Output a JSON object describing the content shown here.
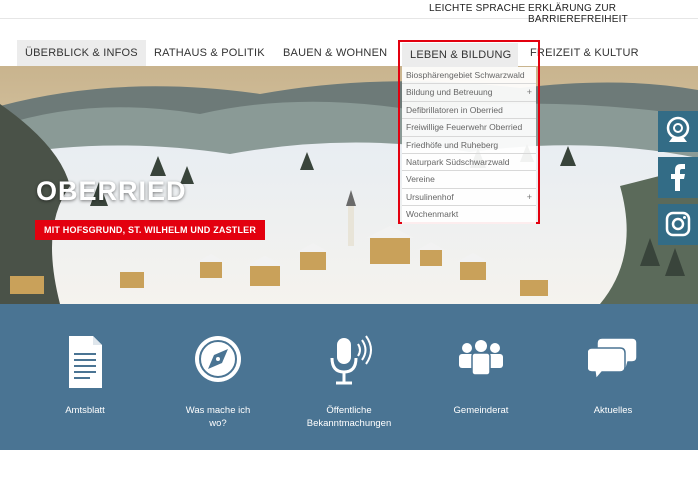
{
  "topbar": {
    "links": [
      "LEICHTE SPRACHE",
      "ERKLÄRUNG ZUR BARRIEREFREIHEIT"
    ]
  },
  "nav": {
    "items": [
      "ÜBERBLICK & INFOS",
      "RATHAUS & POLITIK",
      "BAUEN & WOHNEN",
      "LEBEN & BILDUNG",
      "FREIZEIT & KULTUR"
    ],
    "active": "ÜBERBLICK & INFOS"
  },
  "dropdown": {
    "heading": "LEBEN & BILDUNG",
    "items": [
      {
        "label": "Biosphärengebiet Schwarzwald",
        "has_sub": false
      },
      {
        "label": "Bildung und Betreuung",
        "has_sub": true
      },
      {
        "label": "Defibrillatoren in Oberried",
        "has_sub": false
      },
      {
        "label": "Freiwillige Feuerwehr Oberried",
        "has_sub": false
      },
      {
        "label": "Friedhöfe und Ruheberg",
        "has_sub": false
      },
      {
        "label": "Naturpark Südschwarzwald",
        "has_sub": false
      },
      {
        "label": "Vereine",
        "has_sub": false
      },
      {
        "label": "Ursulinenhof",
        "has_sub": true
      },
      {
        "label": "Wochenmarkt",
        "has_sub": false
      }
    ],
    "highlight_color": "#e3000f"
  },
  "hero": {
    "title": "OBERRIED",
    "subtitle": "MIT HOFSGRUND, ST. WILHELM UND ZASTLER"
  },
  "social": [
    "webcam-icon",
    "facebook-icon",
    "instagram-icon"
  ],
  "quicklinks": [
    {
      "label": "Amtsblatt",
      "icon": "document-icon"
    },
    {
      "label": "Was mache ich wo?",
      "icon": "compass-icon"
    },
    {
      "label": "Öffentliche Bekanntmachungen",
      "icon": "microphone-icon"
    },
    {
      "label": "Gemeinderat",
      "icon": "group-icon"
    },
    {
      "label": "Aktuelles",
      "icon": "chat-bubbles-icon"
    }
  ],
  "colors": {
    "accent": "#e3000f",
    "band": "#4a7493",
    "social": "#336c86"
  }
}
